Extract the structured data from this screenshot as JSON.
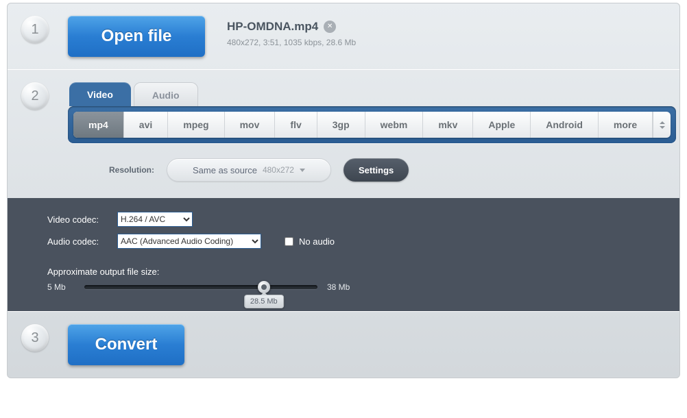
{
  "step1": {
    "num": "1",
    "open_label": "Open file",
    "filename": "HP-OMDNA.mp4",
    "meta": "480x272, 3:51, 1035 kbps, 28.6 Mb"
  },
  "step2": {
    "num": "2",
    "tabs": {
      "video": "Video",
      "audio": "Audio"
    },
    "formats": [
      "mp4",
      "avi",
      "mpeg",
      "mov",
      "flv",
      "3gp",
      "webm",
      "mkv",
      "Apple",
      "Android",
      "more"
    ],
    "resolution": {
      "label": "Resolution:",
      "text": "Same as source",
      "sub": "480x272"
    },
    "settings": "Settings",
    "video_codec": {
      "label": "Video codec:",
      "value": "H.264 / AVC"
    },
    "audio_codec": {
      "label": "Audio codec:",
      "value": "AAC (Advanced Audio Coding)",
      "no_audio": "No audio"
    },
    "approx_label": "Approximate output file size:",
    "slider": {
      "min": "5 Mb",
      "max": "38 Mb",
      "value": "28.5 Mb",
      "percent": 77
    }
  },
  "step3": {
    "num": "3",
    "convert_label": "Convert"
  }
}
